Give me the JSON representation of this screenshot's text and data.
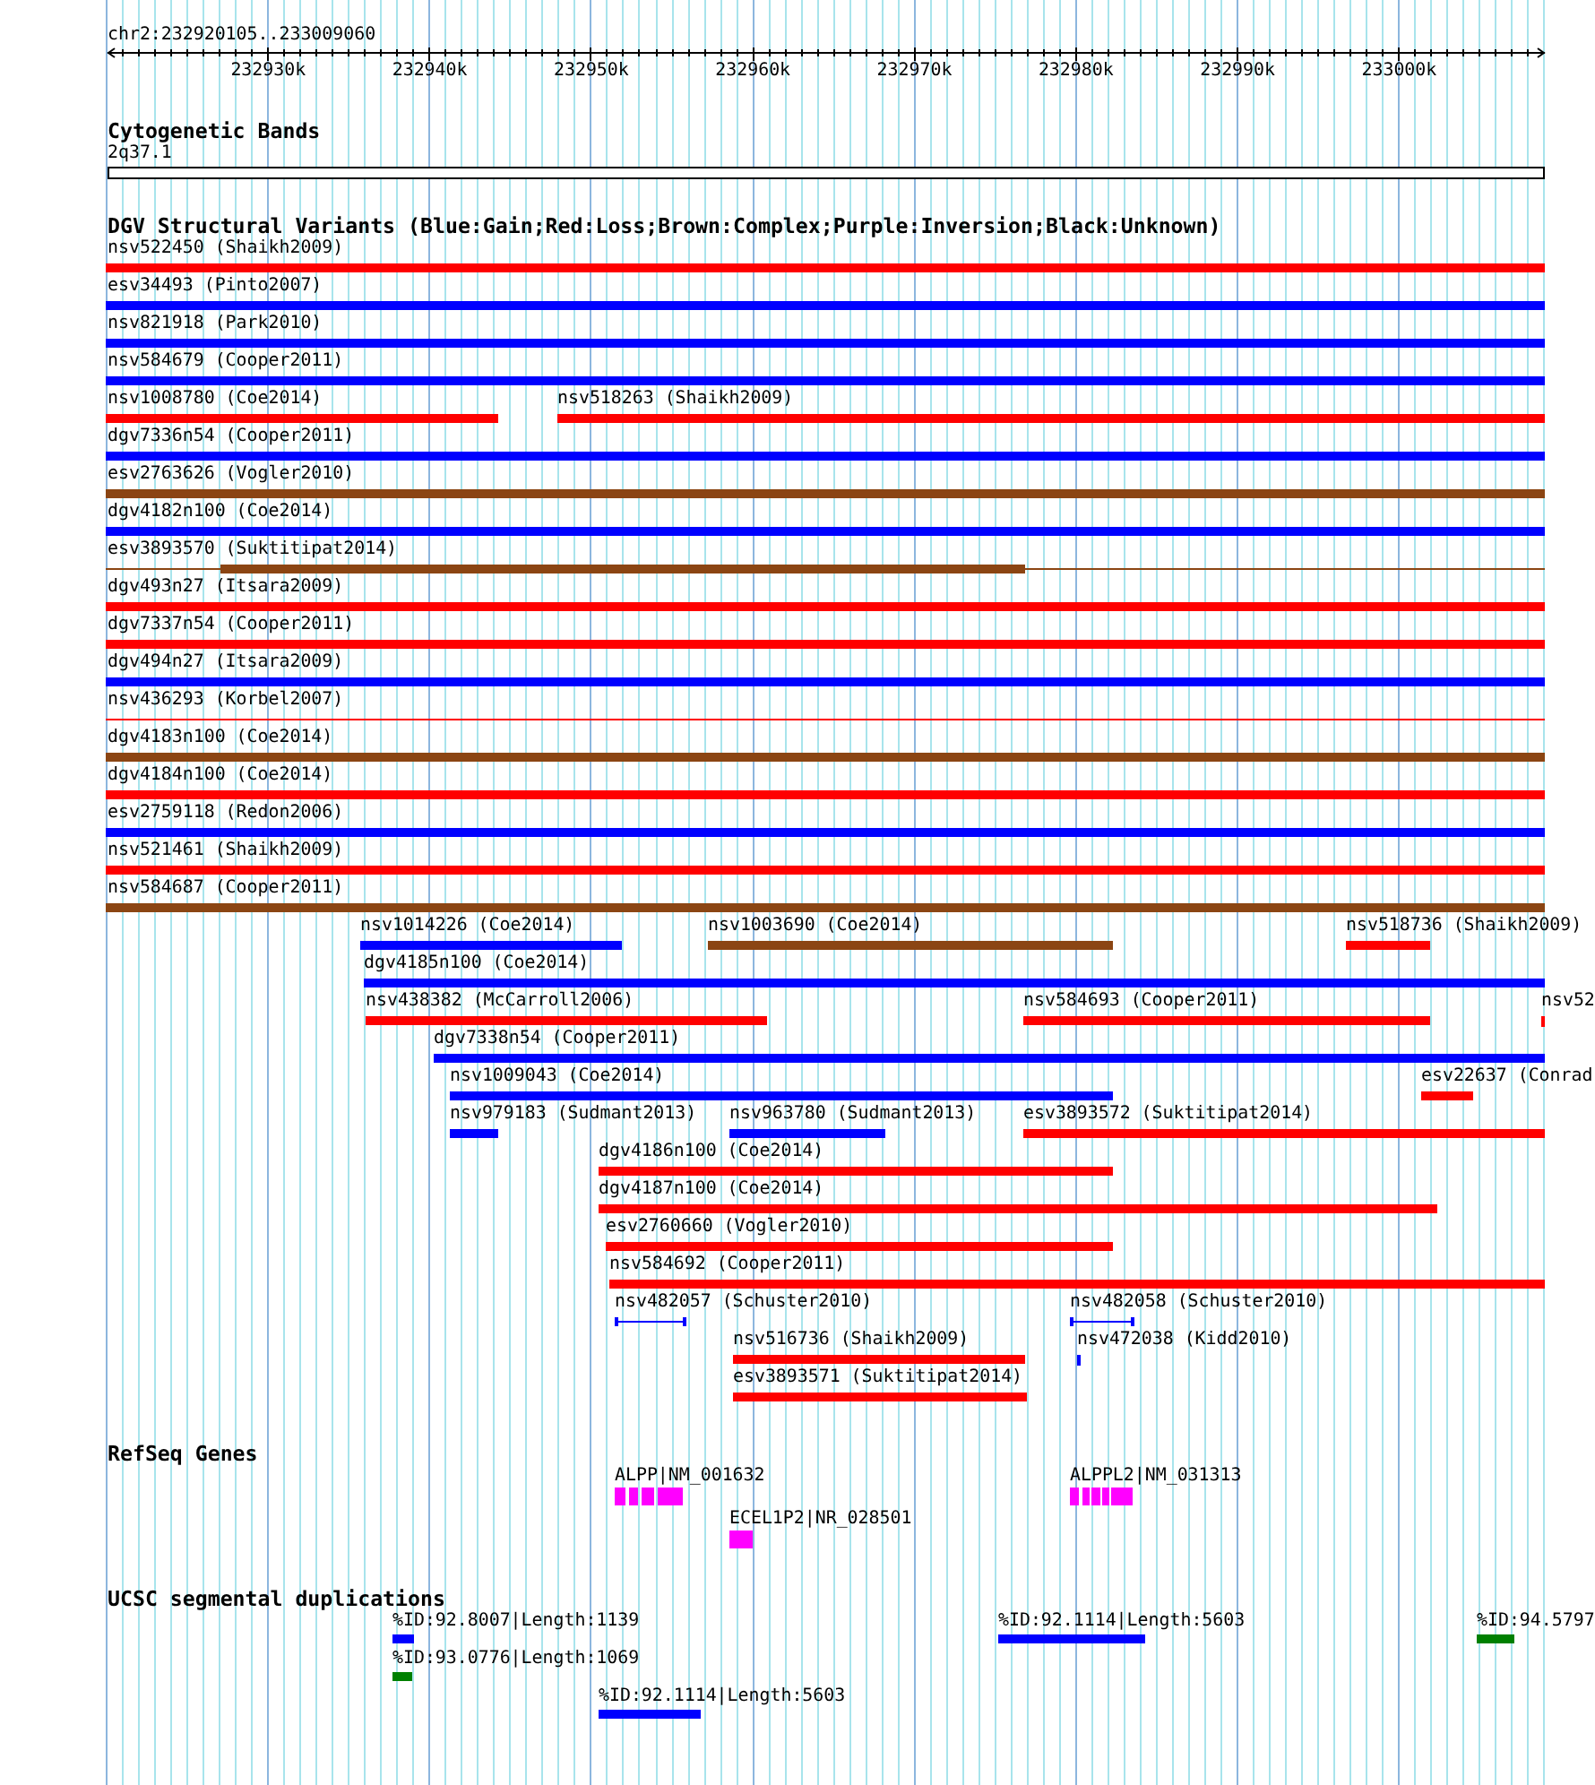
{
  "ruler": {
    "title": "chr2:232920105..233009060",
    "ticks": [
      "232930k",
      "232940k",
      "232950k",
      "232960k",
      "232970k",
      "232980k",
      "232990k",
      "233000k"
    ]
  },
  "cytobands": {
    "title": "Cytogenetic Bands",
    "bands": [
      {
        "name": "2q37.1"
      }
    ]
  },
  "dgv": {
    "title": "DGV Structural Variants (Blue:Gain;Red:Loss;Brown:Complex;Purple:Inversion;Black:Unknown)",
    "rows": [
      {
        "features": [
          {
            "kind": "block",
            "label": "nsv522450 (Shaikh2009)",
            "color": "#ff0000"
          }
        ]
      },
      {
        "features": [
          {
            "kind": "block",
            "label": "esv34493 (Pinto2007)",
            "color": "#0000ff"
          }
        ]
      },
      {
        "features": [
          {
            "kind": "block",
            "label": "nsv821918 (Park2010)",
            "color": "#0000ff"
          }
        ]
      },
      {
        "features": [
          {
            "kind": "block",
            "label": "nsv584679 (Cooper2011)",
            "color": "#0000ff"
          }
        ]
      },
      {
        "features": [
          {
            "kind": "block",
            "label": "nsv1008780 (Coe2014)",
            "color": "#ff0000"
          },
          {
            "kind": "block",
            "label": "nsv518263 (Shaikh2009)",
            "color": "#ff0000"
          }
        ]
      },
      {
        "features": [
          {
            "kind": "block",
            "label": "dgv7336n54 (Cooper2011)",
            "color": "#0000ff"
          }
        ]
      },
      {
        "features": [
          {
            "kind": "block",
            "label": "esv2763626 (Vogler2010)",
            "color": "#8b4513"
          }
        ]
      },
      {
        "features": [
          {
            "kind": "block",
            "label": "dgv4182n100 (Coe2014)",
            "color": "#0000ff"
          }
        ]
      },
      {
        "features": [
          {
            "kind": "block-on-line",
            "label": "esv3893570 (Suktitipat2014)",
            "color": "#8b4513"
          }
        ]
      },
      {
        "features": [
          {
            "kind": "block",
            "label": "dgv493n27 (Itsara2009)",
            "color": "#ff0000"
          }
        ]
      },
      {
        "features": [
          {
            "kind": "block",
            "label": "dgv7337n54 (Cooper2011)",
            "color": "#ff0000"
          }
        ]
      },
      {
        "features": [
          {
            "kind": "block",
            "label": "dgv494n27 (Itsara2009)",
            "color": "#0000ff"
          }
        ]
      },
      {
        "features": [
          {
            "kind": "line",
            "label": "nsv436293 (Korbel2007)",
            "color": "#ff0000"
          }
        ]
      },
      {
        "features": [
          {
            "kind": "block",
            "label": "dgv4183n100 (Coe2014)",
            "color": "#8b4513"
          }
        ]
      },
      {
        "features": [
          {
            "kind": "block",
            "label": "dgv4184n100 (Coe2014)",
            "color": "#ff0000"
          }
        ]
      },
      {
        "features": [
          {
            "kind": "block",
            "label": "esv2759118 (Redon2006)",
            "color": "#0000ff"
          }
        ]
      },
      {
        "features": [
          {
            "kind": "block",
            "label": "nsv521461 (Shaikh2009)",
            "color": "#ff0000"
          }
        ]
      },
      {
        "features": [
          {
            "kind": "block",
            "label": "nsv584687 (Cooper2011)",
            "color": "#8b4513"
          }
        ]
      },
      {
        "features": [
          {
            "kind": "block",
            "label": "nsv1014226 (Coe2014)",
            "color": "#0000ff"
          },
          {
            "kind": "block",
            "label": "nsv1003690 (Coe2014)",
            "color": "#8b4513"
          },
          {
            "kind": "block",
            "label": "nsv518736 (Shaikh2009)",
            "color": "#ff0000"
          }
        ]
      },
      {
        "features": [
          {
            "kind": "block",
            "label": "dgv4185n100 (Coe2014)",
            "color": "#0000ff"
          }
        ]
      },
      {
        "features": [
          {
            "kind": "block",
            "label": "nsv438382 (McCarroll2006)",
            "color": "#ff0000"
          },
          {
            "kind": "block",
            "label": "nsv584693 (Cooper2011)",
            "color": "#ff0000"
          },
          {
            "kind": "block",
            "label": "nsv52",
            "color": "#ff0000"
          }
        ]
      },
      {
        "features": [
          {
            "kind": "block",
            "label": "dgv7338n54 (Cooper2011)",
            "color": "#0000ff"
          }
        ]
      },
      {
        "features": [
          {
            "kind": "block",
            "label": "nsv1009043 (Coe2014)",
            "color": "#0000ff"
          },
          {
            "kind": "block",
            "label": "esv22637 (Conrad",
            "color": "#ff0000"
          }
        ]
      },
      {
        "features": [
          {
            "kind": "block",
            "label": "nsv979183 (Sudmant2013)",
            "color": "#0000ff"
          },
          {
            "kind": "block",
            "label": "nsv963780 (Sudmant2013)",
            "color": "#0000ff"
          },
          {
            "kind": "block",
            "label": "esv3893572 (Suktitipat2014)",
            "color": "#ff0000"
          }
        ]
      },
      {
        "features": [
          {
            "kind": "block",
            "label": "dgv4186n100 (Coe2014)",
            "color": "#ff0000"
          }
        ]
      },
      {
        "features": [
          {
            "kind": "block",
            "label": "dgv4187n100 (Coe2014)",
            "color": "#ff0000"
          }
        ]
      },
      {
        "features": [
          {
            "kind": "block",
            "label": "esv2760660 (Vogler2010)",
            "color": "#ff0000"
          }
        ]
      },
      {
        "features": [
          {
            "kind": "block",
            "label": "nsv584692 (Cooper2011)",
            "color": "#ff0000"
          }
        ]
      },
      {
        "features": [
          {
            "kind": "interval",
            "label": "nsv482057 (Schuster2010)",
            "color": "#0000ff"
          },
          {
            "kind": "interval",
            "label": "nsv482058 (Schuster2010)",
            "color": "#0000ff"
          }
        ]
      },
      {
        "features": [
          {
            "kind": "block",
            "label": "nsv516736 (Shaikh2009)",
            "color": "#ff0000"
          },
          {
            "kind": "block",
            "label": "nsv472038 (Kidd2010)",
            "color": "#0000ff"
          }
        ]
      },
      {
        "features": [
          {
            "kind": "block",
            "label": "esv3893571 (Suktitipat2014)",
            "color": "#ff0000"
          }
        ]
      }
    ]
  },
  "refseq": {
    "title": "RefSeq Genes",
    "rows": [
      {
        "genes": [
          {
            "label": "ALPP|NM_001632"
          },
          {
            "label": "ALPPL2|NM_031313"
          }
        ]
      },
      {
        "genes": [
          {
            "label": "ECEL1P2|NR_028501"
          }
        ]
      }
    ]
  },
  "segdups": {
    "title": "UCSC segmental duplications",
    "rows": [
      {
        "items": [
          {
            "label": "%ID:92.8007|Length:1139",
            "color": "#0000ff"
          },
          {
            "label": "%ID:92.1114|Length:5603",
            "color": "#0000ff"
          },
          {
            "label": "%ID:94.5797",
            "color": "#008000"
          }
        ]
      },
      {
        "items": [
          {
            "label": "%ID:93.0776|Length:1069",
            "color": "#008000"
          }
        ]
      },
      {
        "items": [
          {
            "label": "%ID:92.1114|Length:5603",
            "color": "#0000ff"
          }
        ]
      }
    ]
  }
}
